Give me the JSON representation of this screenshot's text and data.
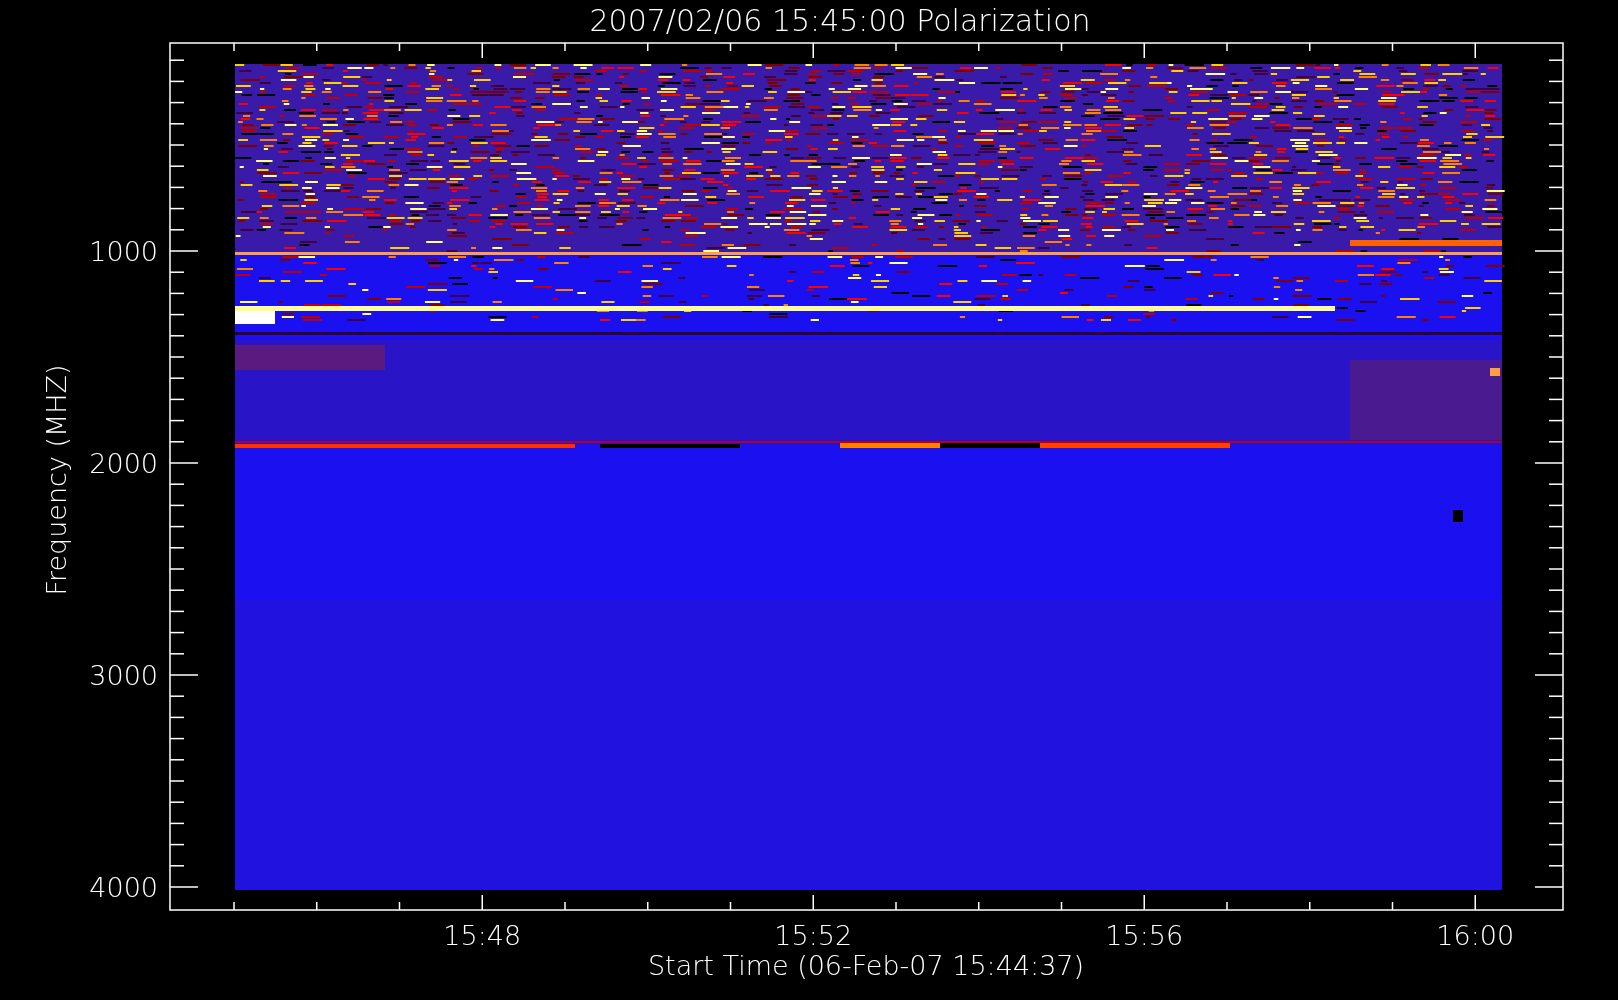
{
  "title": "2007/02/06 15:45:00 Polarization",
  "plot": {
    "ylabel": "Frequency (MHZ)",
    "xlabel": "Start Time (06-Feb-07 15:44:37)",
    "yticks": [
      "1000",
      "2000",
      "3000",
      "4000"
    ],
    "xticks": [
      "15:48",
      "15:52",
      "15:56",
      "16:00"
    ]
  }
}
